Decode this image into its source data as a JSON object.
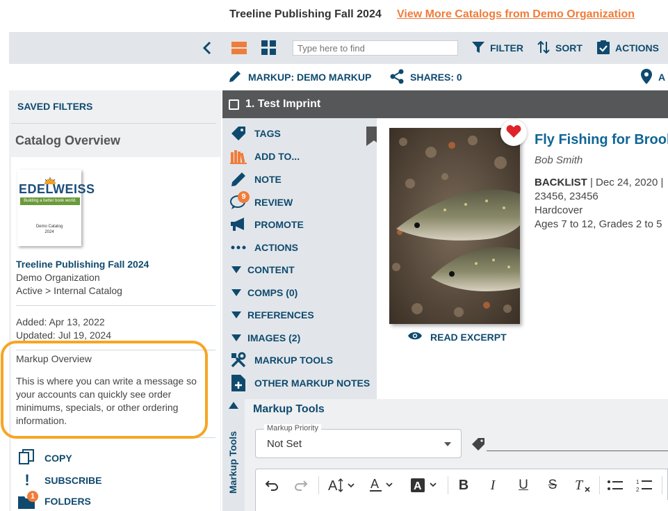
{
  "header": {
    "catalog_title": "Treeline Publishing Fall 2024",
    "more_link": "View More Catalogs from Demo Organization"
  },
  "toolbar": {
    "search_placeholder": "Type here to find",
    "filter_label": "FILTER",
    "sort_label": "SORT",
    "actions_label": "ACTIONS",
    "active_view": "list",
    "accent_color": "#f07c3a"
  },
  "markup_row": {
    "markup_label": "MARKUP: DEMO MARKUP",
    "shares_label": "SHARES: 0",
    "cut_label": "A"
  },
  "sidebar": {
    "saved_filters": "SAVED FILTERS",
    "overview_title": "Catalog Overview",
    "cover": {
      "logo": "EDELWEISS",
      "tagline": "Building a better book world.",
      "caption_line1": "Demo Catalog",
      "caption_line2": "2024"
    },
    "catalog_name": "Treeline Publishing Fall 2024",
    "org": "Demo Organization",
    "status": "Active > Internal Catalog",
    "added": "Added: Apr 13, 2022",
    "updated": "Updated: Jul 19, 2024",
    "markup_overview_title": "Markup Overview",
    "markup_overview_text": "This is where you can write a message so your accounts can quickly see order minimums, specials, or other ordering information.",
    "actions": [
      {
        "label": "COPY",
        "icon": "copy-icon"
      },
      {
        "label": "SUBSCRIBE",
        "icon": "exclamation-icon"
      },
      {
        "label": "FOLDERS",
        "icon": "folder-icon",
        "badge": "1"
      }
    ]
  },
  "imprint": {
    "label": "1. Test Imprint"
  },
  "item_actions": [
    {
      "label": "TAGS",
      "icon": "tag-icon"
    },
    {
      "label": "ADD TO...",
      "icon": "books-icon"
    },
    {
      "label": "NOTE",
      "icon": "pencil-icon"
    },
    {
      "label": "REVIEW",
      "icon": "comment-icon",
      "badge": "9"
    },
    {
      "label": "PROMOTE",
      "icon": "megaphone-icon"
    },
    {
      "label": "ACTIONS",
      "icon": "ellipsis-icon"
    },
    {
      "label": "CONTENT",
      "icon": "caret-down-icon"
    },
    {
      "label": "COMPS (0)",
      "icon": "caret-down-icon"
    },
    {
      "label": "REFERENCES",
      "icon": "caret-down-icon"
    },
    {
      "label": "IMAGES (2)",
      "icon": "caret-down-icon"
    },
    {
      "label": "MARKUP TOOLS",
      "icon": "tools-icon"
    },
    {
      "label": "OTHER MARKUP NOTES",
      "icon": "note-add-icon"
    }
  ],
  "product": {
    "title": "Fly Fishing for Brook",
    "author": "Bob Smith",
    "status": "BACKLIST",
    "date_line": " | Dec 24, 2020 |",
    "isbn": "23456, 23456",
    "format": "Hardcover",
    "ages": "Ages 7 to 12, Grades 2 to 5",
    "read_excerpt": "READ EXCERPT",
    "favorited": true
  },
  "markup_tools": {
    "tab_label": "Markup Tools",
    "title": "Markup Tools",
    "priority_label": "Markup Priority",
    "priority_value": "Not Set",
    "editor_buttons": [
      "undo-icon",
      "redo-icon",
      "font-size-icon",
      "font-color-icon",
      "highlight-color-icon",
      "bold-icon",
      "italic-icon",
      "underline-icon",
      "strikethrough-icon",
      "clear-format-icon",
      "bullet-list-icon",
      "numbered-list-icon"
    ]
  }
}
